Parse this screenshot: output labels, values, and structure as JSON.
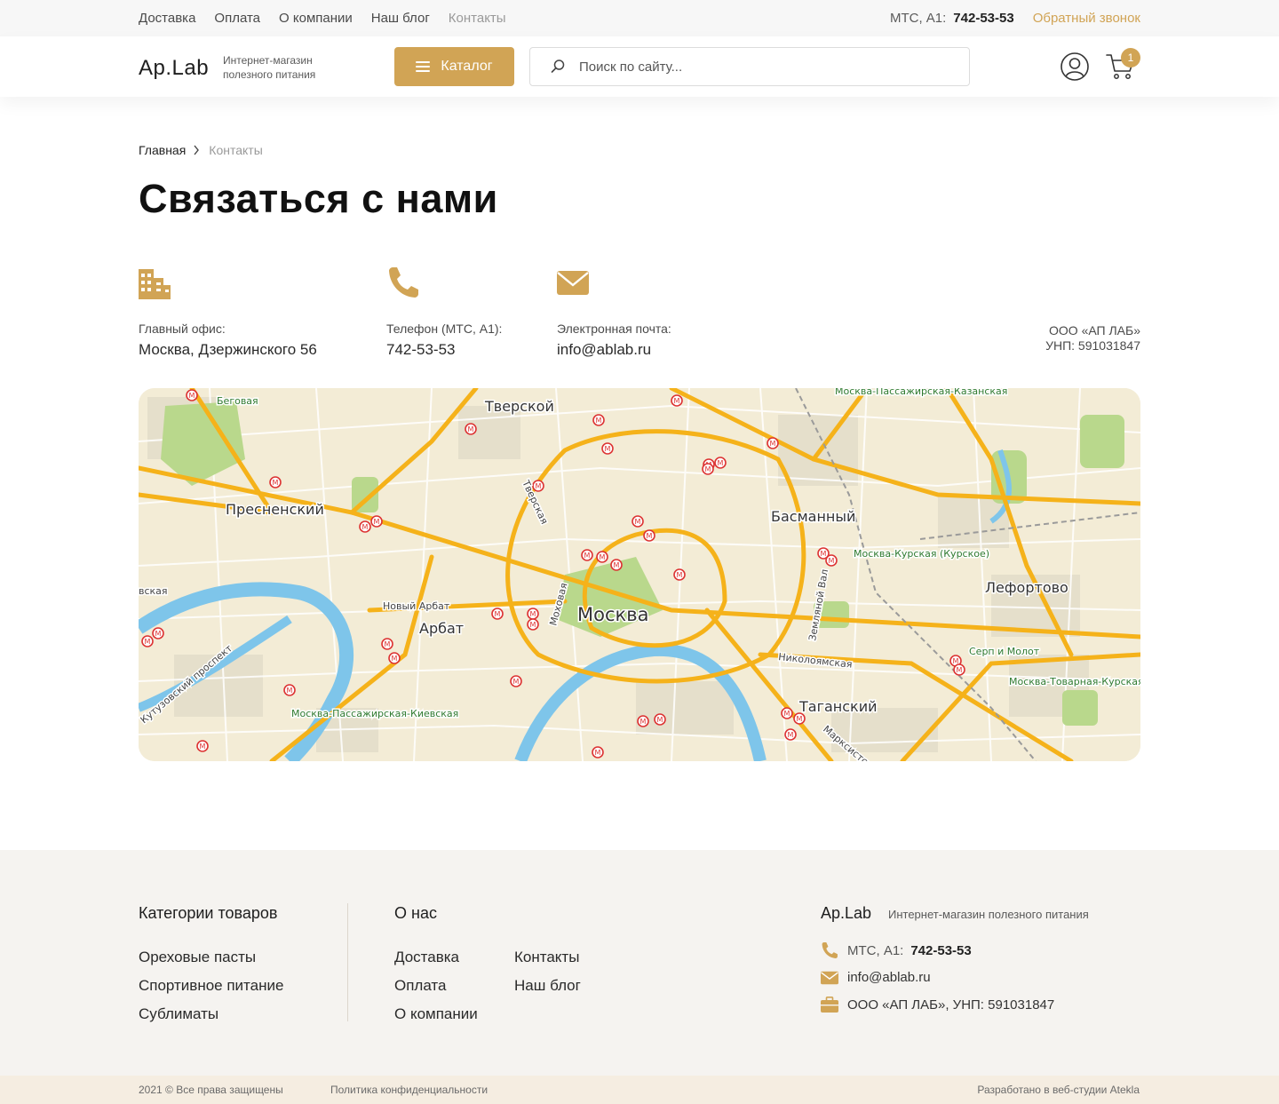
{
  "topbar": {
    "nav": [
      "Доставка",
      "Оплата",
      "О компании",
      "Наш блог",
      "Контакты"
    ],
    "operators": "МТС, А1:",
    "phone": "742-53-53",
    "callback": "Обратный звонок"
  },
  "header": {
    "logo": "Ap.Lab",
    "tagline": "Интернет-магазин полезного питания",
    "catalog_label": "Каталог",
    "search_placeholder": "Поиск по сайту...",
    "cart_count": "1"
  },
  "breadcrumb": {
    "home": "Главная",
    "current": "Контакты"
  },
  "page_title": "Связаться с нами",
  "contacts": {
    "office_label": "Главный офис:",
    "office_value": "Москва, Дзержинского 56",
    "phone_label": "Телефон (МТС, А1):",
    "phone_value": "742-53-53",
    "email_label": "Электронная почта:",
    "email_value": "info@ablab.ru",
    "company_name": "ООО «АП ЛАБ»",
    "company_unp": "УНП: 591031847"
  },
  "map": {
    "center_label": "Москва",
    "labels": [
      "Тверской",
      "Пресненский",
      "Басманный",
      "Лефортово",
      "Арбат",
      "Таганский",
      "Беговая",
      "Москва-Пассажирская-Казанская",
      "Москва-Курская (Курское)",
      "Серп и Молот",
      "Москва-Товарная-Курская",
      "Москва-Пассажирская-Киевская",
      "Новый Арбат",
      "Николоямская",
      "Кутузовский проспект",
      "Земляной Вал",
      "Тверская",
      "Моховая",
      "Марксистская",
      "вская"
    ]
  },
  "footer": {
    "categories_title": "Категории товаров",
    "categories": [
      "Ореховые пасты",
      "Спортивное питание",
      "Сублиматы"
    ],
    "about_title": "О нас",
    "about_col1": [
      "Доставка",
      "Оплата",
      "О компании"
    ],
    "about_col2": [
      "Контакты",
      "Наш блог"
    ],
    "logo": "Ap.Lab",
    "tagline": "Интернет-магазин полезного питания",
    "operators": "МТС, А1:",
    "phone": "742-53-53",
    "email": "info@ablab.ru",
    "company": "ООО «АП ЛАБ», УНП: 591031847"
  },
  "bottom": {
    "copyright": "2021 © Все права защищены",
    "policy": "Политика конфиденциальности",
    "developer": "Разработано в веб-студии Atekla"
  },
  "colors": {
    "accent": "#d1a455",
    "footer_bg": "#f5f3f0",
    "bottom_bg": "#f5ede1"
  }
}
